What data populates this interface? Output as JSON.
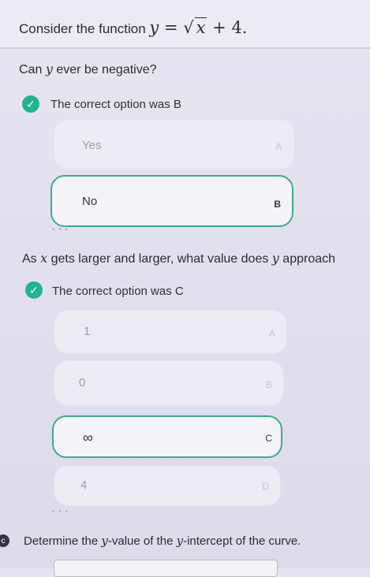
{
  "stem": {
    "prefix": "Consider the function",
    "y": "y",
    "eq": "=",
    "x": "x",
    "suffix": "+ 4."
  },
  "questions": [
    {
      "text_prefix": "Can",
      "var": "y",
      "text_suffix": "ever be negative?",
      "feedback": "The correct option was B",
      "options": [
        {
          "label": "Yes",
          "letter": "A",
          "selected": false
        },
        {
          "label": "No",
          "letter": "B",
          "selected": true
        }
      ]
    },
    {
      "text_prefix": "As",
      "var1": "x",
      "text_mid": "gets larger and larger, what value does",
      "var2": "y",
      "text_suffix": "approach",
      "feedback": "The correct option was C",
      "options": [
        {
          "label": "1",
          "letter": "A",
          "selected": false
        },
        {
          "label": "0",
          "letter": "B",
          "selected": false
        },
        {
          "label": "∞",
          "letter": "C",
          "selected": true
        },
        {
          "label": "4",
          "letter": "D",
          "selected": false
        }
      ]
    },
    {
      "number": "c",
      "text_prefix": "Determine the",
      "var1": "y",
      "text_mid": "-value of the",
      "var2": "y",
      "text_suffix": "-intercept of the curve."
    }
  ],
  "icons": {
    "check": "check-icon"
  },
  "colors": {
    "accent": "#21b58c",
    "selected_border": "#3fa890"
  },
  "dots": "• • •"
}
